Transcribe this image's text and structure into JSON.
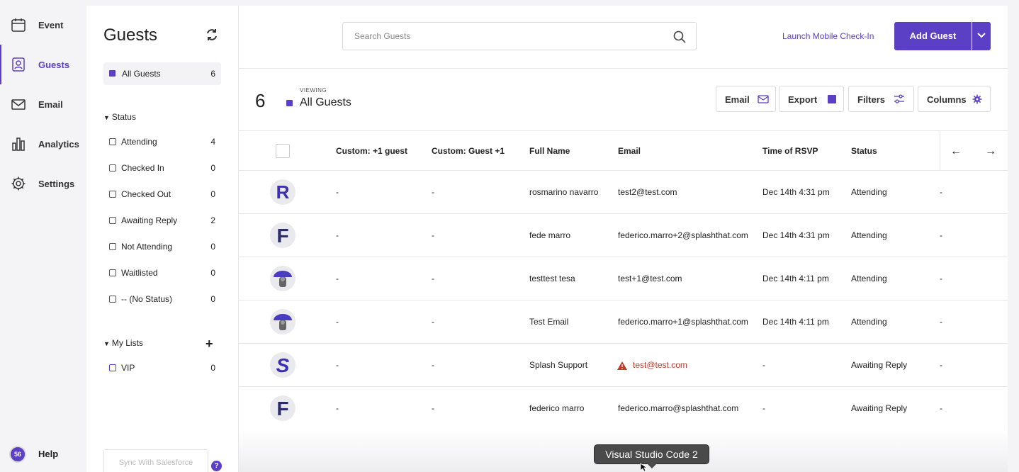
{
  "nav": {
    "items": [
      {
        "label": "Event",
        "icon": "calendar-icon"
      },
      {
        "label": "Guests",
        "icon": "guests-icon",
        "active": true
      },
      {
        "label": "Email",
        "icon": "envelope-icon"
      },
      {
        "label": "Analytics",
        "icon": "bar-chart-icon"
      },
      {
        "label": "Settings",
        "icon": "gear-icon"
      }
    ],
    "help_label": "Help",
    "help_badge": "56"
  },
  "sidebar": {
    "title": "Guests",
    "all_guests": {
      "label": "All Guests",
      "count": "6"
    },
    "status_heading": "Status",
    "statuses": [
      {
        "label": "Attending",
        "count": "4"
      },
      {
        "label": "Checked In",
        "count": "0"
      },
      {
        "label": "Checked Out",
        "count": "0"
      },
      {
        "label": "Awaiting Reply",
        "count": "2"
      },
      {
        "label": "Not Attending",
        "count": "0"
      },
      {
        "label": "Waitlisted",
        "count": "0"
      },
      {
        "label": "-- (No Status)",
        "count": "0"
      }
    ],
    "lists_heading": "My Lists",
    "lists": [
      {
        "label": "VIP",
        "count": "0"
      }
    ],
    "sync_label": "Sync With Salesforce",
    "sync_help": "?"
  },
  "topbar": {
    "search_placeholder": "Search Guests",
    "launch_label": "Launch Mobile Check-In",
    "add_label": "Add Guest"
  },
  "viewbar": {
    "count": "6",
    "viewing_label": "VIEWING",
    "view_name": "All Guests",
    "buttons": {
      "email": "Email",
      "export": "Export",
      "filters": "Filters",
      "columns": "Columns"
    }
  },
  "table": {
    "columns": [
      "Custom: +1 guest",
      "Custom: Guest +1",
      "Full Name",
      "Email",
      "Time of RSVP",
      "Status"
    ],
    "rows": [
      {
        "avatar": "R",
        "plus1": "-",
        "guest1": "-",
        "name": "rosmarino navarro",
        "email": "test2@test.com",
        "rsvp": "Dec 14th 4:31 pm",
        "status": "Attending",
        "extra": "-"
      },
      {
        "avatar": "F",
        "plus1": "-",
        "guest1": "-",
        "name": "fede marro",
        "email": "federico.marro+2@splashthat.com",
        "rsvp": "Dec 14th 4:31 pm",
        "status": "Attending",
        "extra": "-"
      },
      {
        "avatar": "umbrella",
        "plus1": "-",
        "guest1": "-",
        "name": "testtest tesa",
        "email": "test+1@test.com",
        "rsvp": "Dec 14th 4:11 pm",
        "status": "Attending",
        "extra": "-"
      },
      {
        "avatar": "umbrella",
        "plus1": "-",
        "guest1": "-",
        "name": "Test Email",
        "email": "federico.marro+1@splashthat.com",
        "rsvp": "Dec 14th 4:11 pm",
        "status": "Attending",
        "extra": "-"
      },
      {
        "avatar": "S",
        "plus1": "-",
        "guest1": "-",
        "name": "Splash Support",
        "email": "test@test.com",
        "email_warning": true,
        "rsvp": "-",
        "status": "Awaiting Reply",
        "extra": "-"
      },
      {
        "avatar": "F",
        "plus1": "-",
        "guest1": "-",
        "name": "federico marro",
        "email": "federico.marro@splashthat.com",
        "rsvp": "-",
        "status": "Awaiting Reply",
        "extra": "-"
      }
    ]
  },
  "tooltip": "Visual Studio Code 2",
  "colors": {
    "accent": "#5b3fc4",
    "error": "#c0392b"
  }
}
